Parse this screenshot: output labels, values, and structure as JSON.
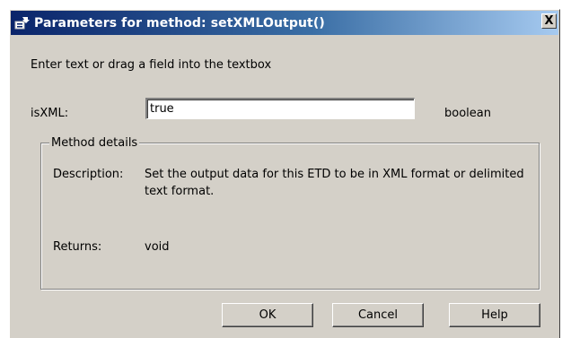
{
  "window": {
    "title": "Parameters for method: setXMLOutput()",
    "close_glyph": "X",
    "title_icon": "wizard-icon"
  },
  "instruction": "Enter text or drag a field into the textbox",
  "parameter": {
    "label": "isXML:",
    "value": "true",
    "type": "boolean"
  },
  "details": {
    "legend": "Method details",
    "description_label": "Description:",
    "description_text": "Set the output data for this ETD to be in XML format or delimited text format.",
    "returns_label": "Returns:",
    "returns_value": "void"
  },
  "buttons": {
    "ok": "OK",
    "cancel": "Cancel",
    "help": "Help"
  },
  "colors": {
    "dialog_bg": "#d4d0c8",
    "titlebar_start": "#0a246a",
    "titlebar_end": "#a6caf0"
  }
}
